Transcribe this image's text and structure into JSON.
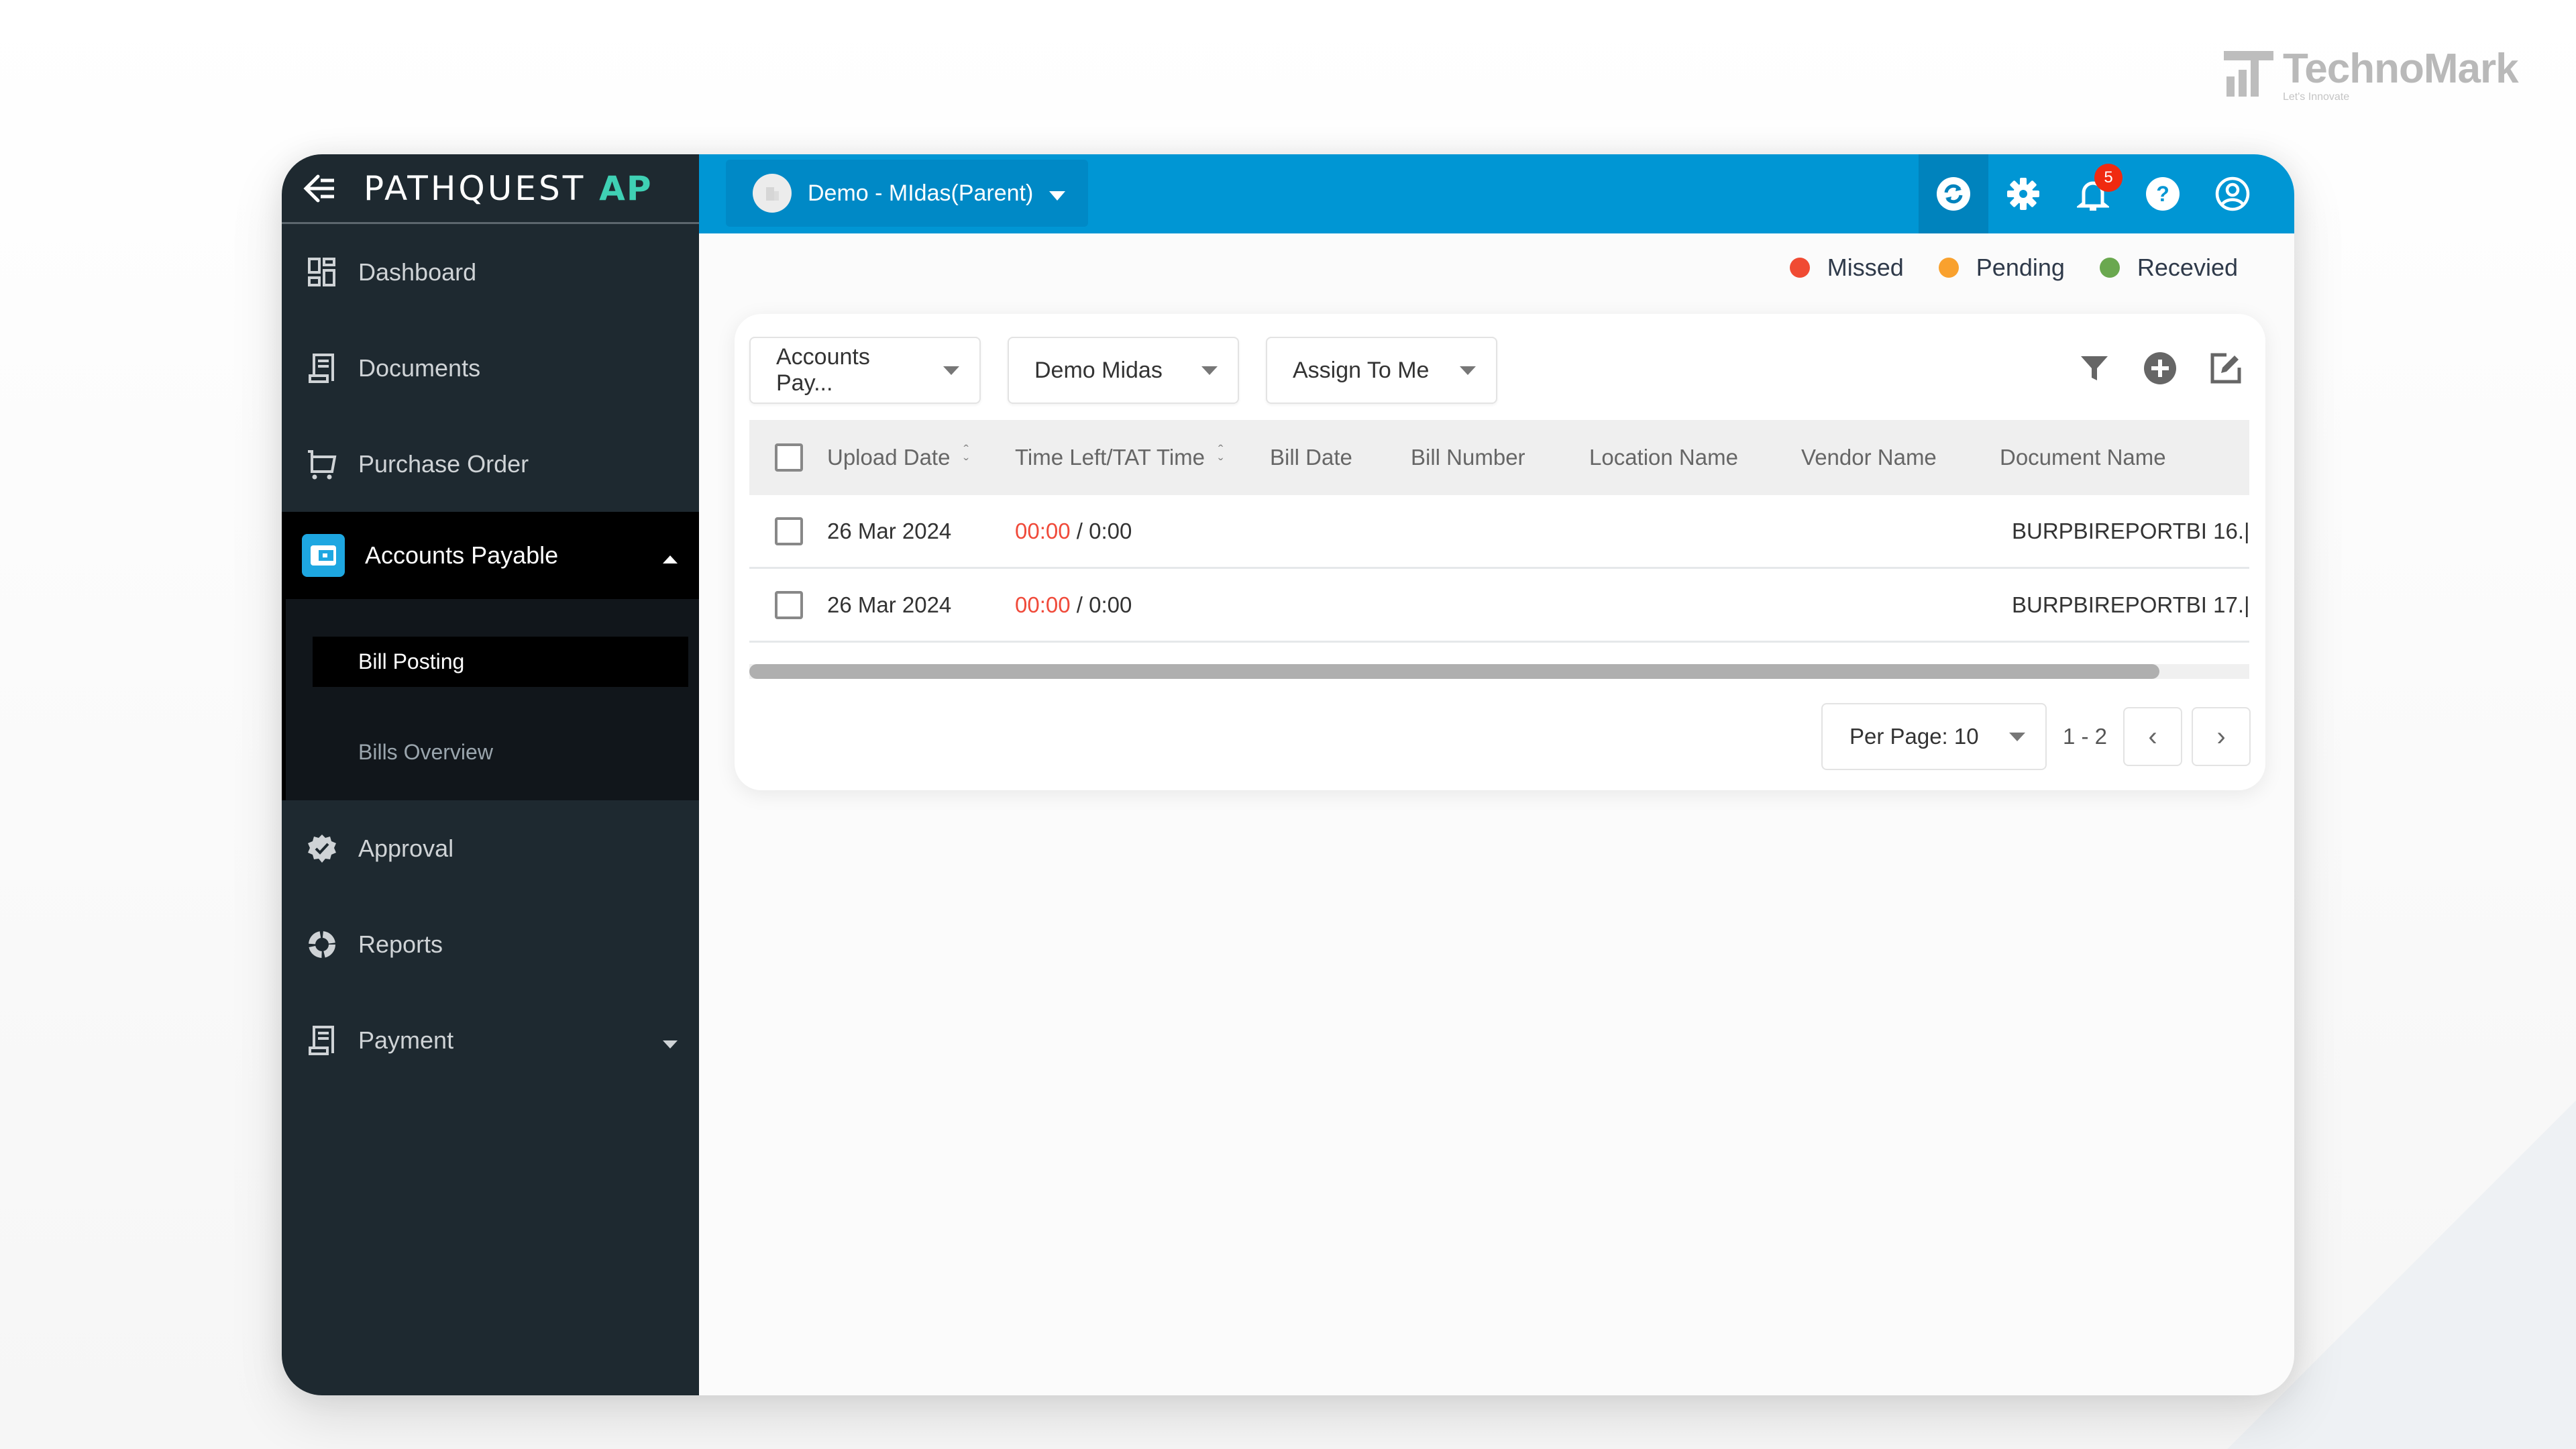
{
  "watermark": {
    "name": "TechnoMark",
    "tagline": "Let's Innovate"
  },
  "sidebar": {
    "logo_main": "PATHQUEST",
    "logo_suffix": "AP",
    "items": [
      {
        "label": "Dashboard",
        "icon": "dashboard-grid-icon"
      },
      {
        "label": "Documents",
        "icon": "document-icon"
      },
      {
        "label": "Purchase Order",
        "icon": "cart-icon"
      },
      {
        "label": "Accounts Payable",
        "icon": "wallet-icon",
        "expanded": true
      },
      {
        "label": "Approval",
        "icon": "badge-check-icon"
      },
      {
        "label": "Reports",
        "icon": "donut-chart-icon"
      },
      {
        "label": "Payment",
        "icon": "receipt-icon",
        "expanded": false
      }
    ],
    "submenu": [
      {
        "label": "Bill Posting",
        "active": true
      },
      {
        "label": "Bills Overview",
        "active": false
      }
    ]
  },
  "topbar": {
    "org_name": "Demo - MIdas(Parent)",
    "notification_count": "5",
    "icons": [
      "sync-icon",
      "gear-icon",
      "bell-icon",
      "help-icon",
      "user-icon"
    ]
  },
  "legend": [
    {
      "label": "Missed",
      "color": "#f04b33"
    },
    {
      "label": "Pending",
      "color": "#f9a12e"
    },
    {
      "label": "Recevied",
      "color": "#6aa84f"
    }
  ],
  "filters": {
    "module": "Accounts Pay...",
    "company": "Demo Midas",
    "assignment": "Assign To Me"
  },
  "table": {
    "columns": [
      "Upload Date",
      "Time Left/TAT Time",
      "Bill Date",
      "Bill Number",
      "Location Name",
      "Vendor Name",
      "Document Name"
    ],
    "rows": [
      {
        "upload_date": "26 Mar 2024",
        "time_left": "00:00",
        "tat_time": "0:00",
        "bill_date": "",
        "bill_number": "",
        "location": "",
        "vendor": "",
        "document": "BURPBIREPORTBI 16.|"
      },
      {
        "upload_date": "26 Mar 2024",
        "time_left": "00:00",
        "tat_time": "0:00",
        "bill_date": "",
        "bill_number": "",
        "location": "",
        "vendor": "",
        "document": "BURPBIREPORTBI 17.|"
      }
    ],
    "horizontal_scroll_visible_fraction": 0.94
  },
  "pagination": {
    "per_page_label": "Per Page: 10",
    "range": "1 - 2",
    "prev": "‹",
    "next": "›"
  }
}
